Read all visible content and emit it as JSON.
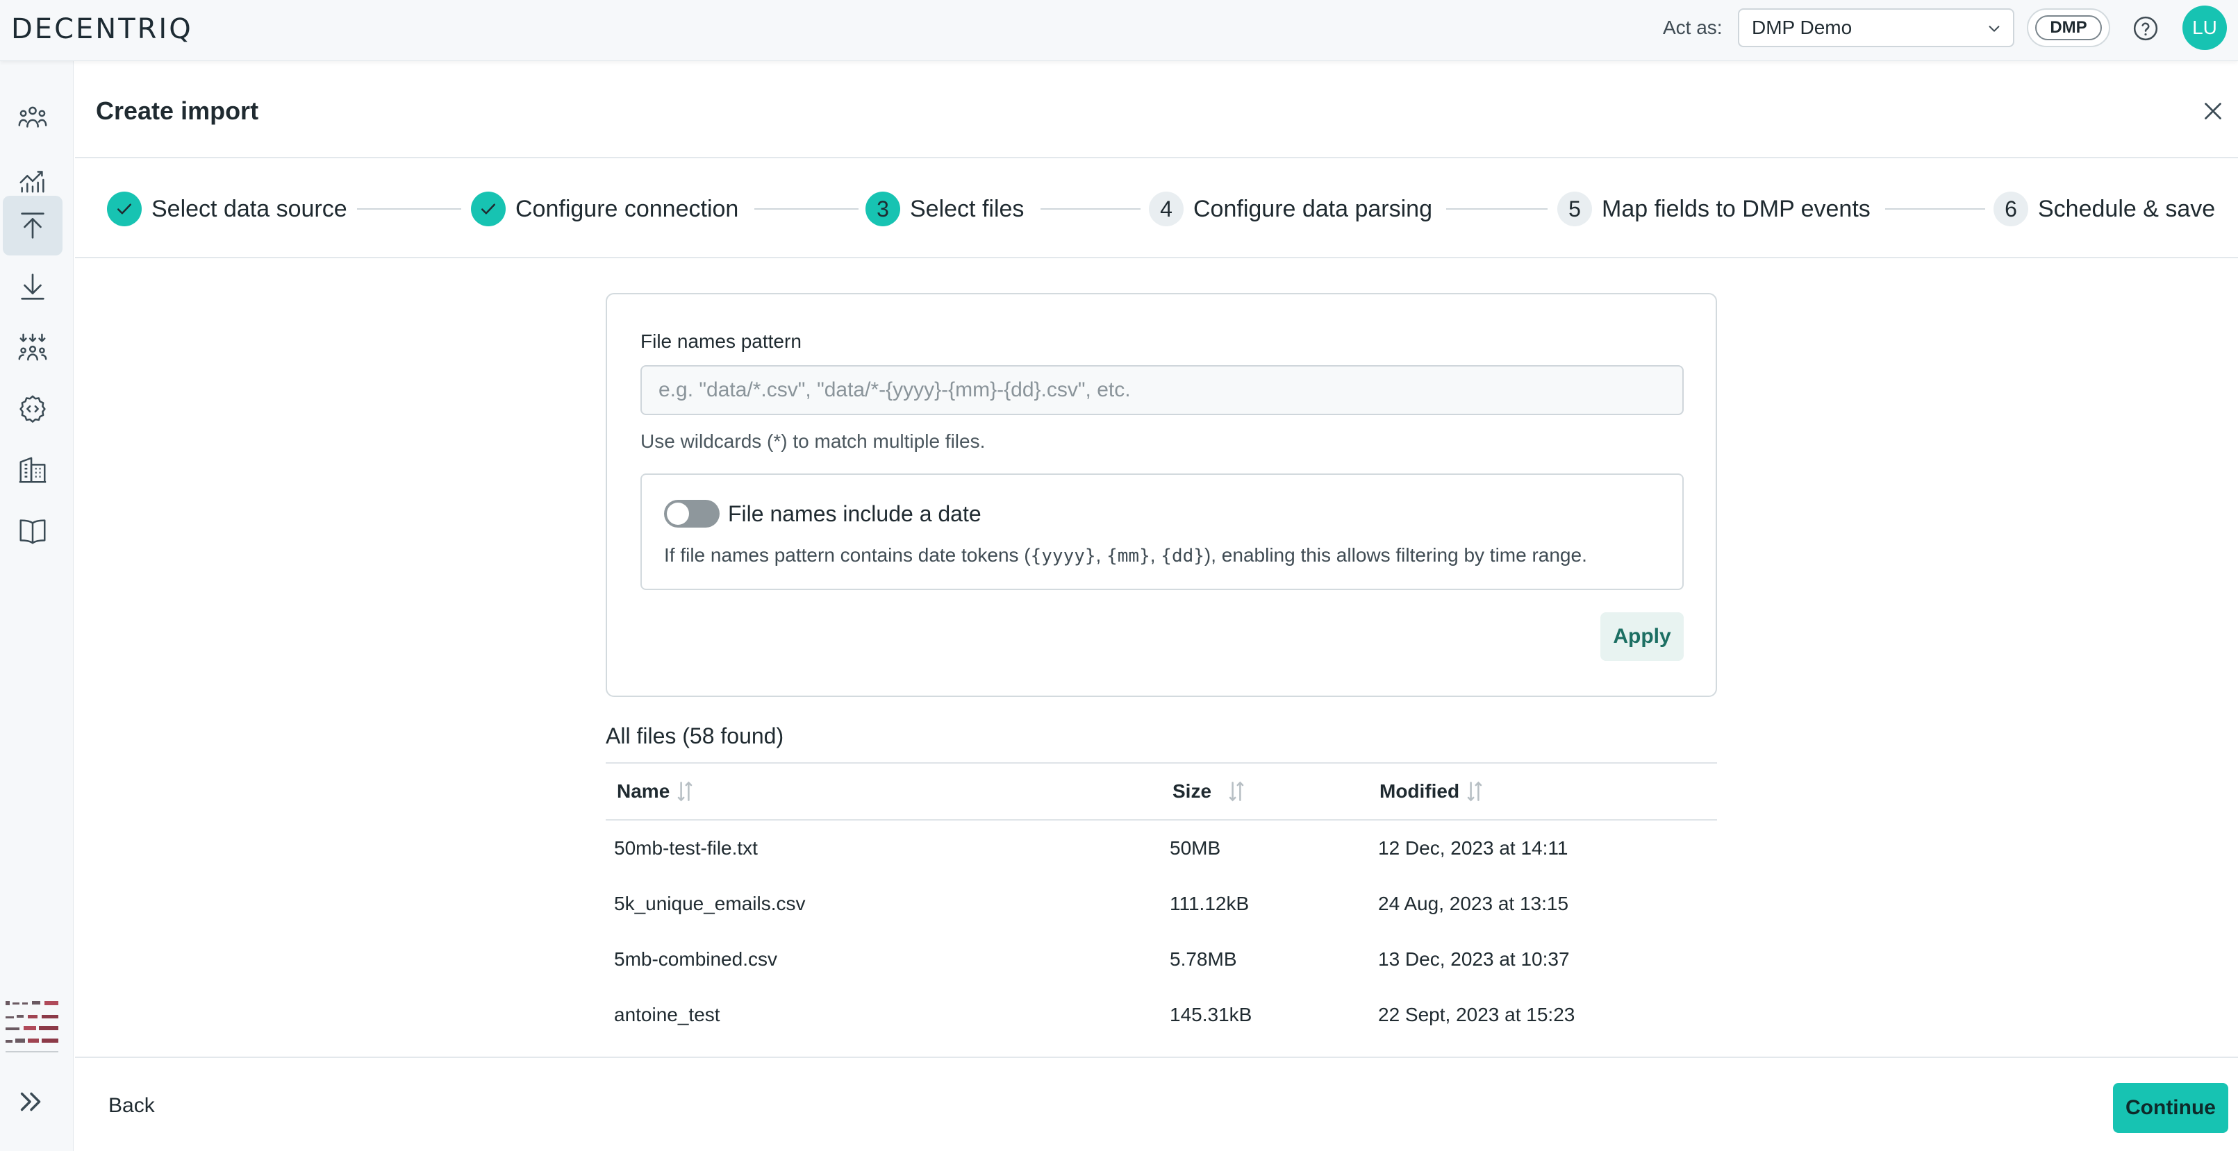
{
  "header": {
    "logo": "DECENTRIQ",
    "act_as_label": "Act as:",
    "act_as_value": "DMP Demo",
    "badge": "DMP",
    "avatar_initials": "LU",
    "accent_color": "#17c3b2"
  },
  "sidebar": {
    "items": [
      {
        "icon": "users-icon"
      },
      {
        "icon": "chart-icon"
      },
      {
        "icon": "upload-icon",
        "active": true
      },
      {
        "icon": "download-icon"
      },
      {
        "icon": "audience-merge-icon"
      },
      {
        "icon": "code-gear-icon"
      },
      {
        "icon": "building-icon"
      },
      {
        "icon": "book-icon"
      }
    ],
    "expand_icon": "chevron-double-right-icon"
  },
  "dialog": {
    "title": "Create import",
    "close_icon": "close-icon"
  },
  "stepper": {
    "steps": [
      {
        "number": "1",
        "label": "Select data source",
        "state": "done"
      },
      {
        "number": "2",
        "label": "Configure connection",
        "state": "done"
      },
      {
        "number": "3",
        "label": "Select files",
        "state": "current"
      },
      {
        "number": "4",
        "label": "Configure data parsing",
        "state": "todo"
      },
      {
        "number": "5",
        "label": "Map fields to DMP events",
        "state": "todo"
      },
      {
        "number": "6",
        "label": "Schedule & save",
        "state": "todo"
      }
    ]
  },
  "form": {
    "pattern_label": "File names pattern",
    "pattern_value": "",
    "pattern_placeholder": "e.g. \"data/*.csv\", \"data/*-{yyyy}-{mm}-{dd}.csv\", etc.",
    "pattern_helper": "Use wildcards (*) to match multiple files.",
    "date_toggle_label": "File names include a date",
    "date_toggle_on": false,
    "date_desc_prefix": "If file names pattern contains date tokens (",
    "date_token_yyyy": "{yyyy}",
    "date_sep_1": ", ",
    "date_token_mm": "{mm}",
    "date_sep_2": ", ",
    "date_token_dd": "{dd}",
    "date_desc_suffix": "), enabling this allows filtering by time range.",
    "apply_label": "Apply"
  },
  "files": {
    "title": "All files (58 found)",
    "columns": {
      "name": "Name",
      "size": "Size",
      "modified": "Modified"
    },
    "rows": [
      {
        "name": "50mb-test-file.txt",
        "size": "50MB",
        "modified": "12 Dec, 2023 at 14:11"
      },
      {
        "name": "5k_unique_emails.csv",
        "size": "111.12kB",
        "modified": "24 Aug, 2023 at 13:15"
      },
      {
        "name": "5mb-combined.csv",
        "size": "5.78MB",
        "modified": "13 Dec, 2023 at 10:37"
      },
      {
        "name": "antoine_test",
        "size": "145.31kB",
        "modified": "22 Sept, 2023 at 15:23"
      }
    ]
  },
  "footer": {
    "back_label": "Back",
    "continue_label": "Continue"
  }
}
